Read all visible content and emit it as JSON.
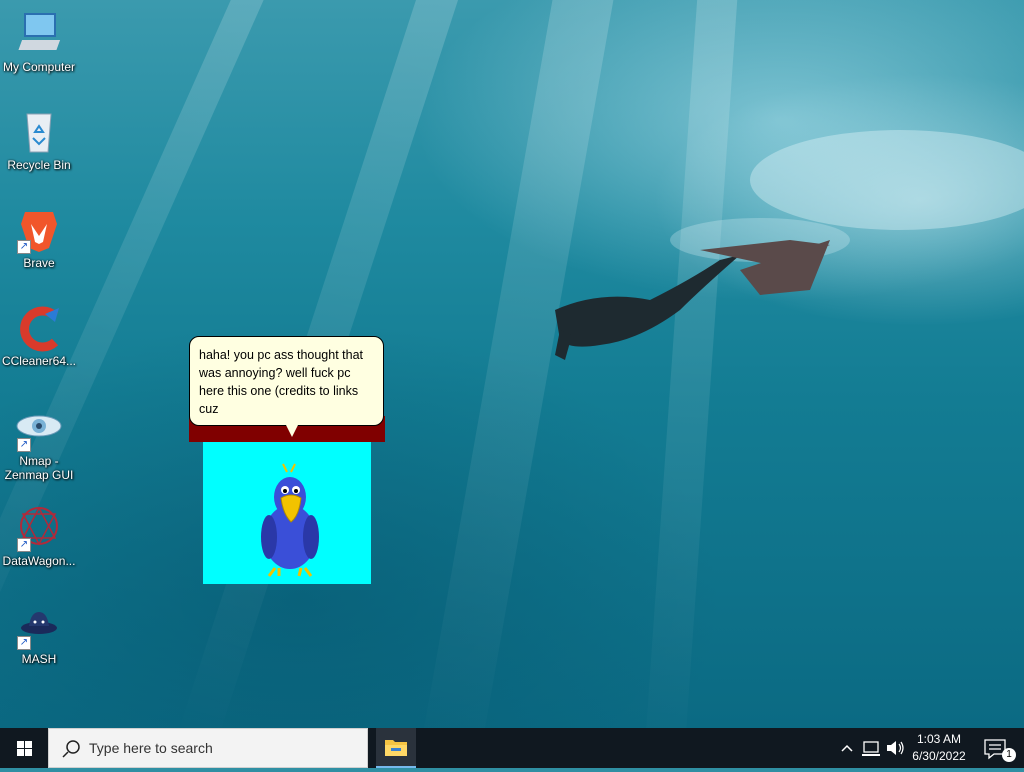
{
  "desktop": {
    "icons": [
      {
        "label": "My Computer",
        "icon": "computer-icon"
      },
      {
        "label": "Recycle Bin",
        "icon": "recycle-bin-icon"
      },
      {
        "label": "Brave",
        "icon": "brave-lion-icon"
      },
      {
        "label": "CCleaner64...",
        "icon": "ccleaner-icon"
      },
      {
        "label": "Nmap -\nZenmap GUI",
        "icon": "nmap-eye-icon"
      },
      {
        "label": "DataWagon...",
        "icon": "datawagon-icon"
      },
      {
        "label": "MASH",
        "icon": "mash-hat-icon"
      }
    ]
  },
  "agent": {
    "speech": "haha! you pc ass thought that was annoying? well fuck pc here this one (credits to links cuz",
    "character": "parrot-icon",
    "background_color": "#00ffff",
    "bar_color": "#800000"
  },
  "taskbar": {
    "search_placeholder": "Type here to search",
    "pinned": [
      {
        "name": "File Explorer",
        "icon": "folder-icon"
      }
    ],
    "tray": {
      "time": "1:03 AM",
      "date": "6/30/2022",
      "notification_count": "1",
      "icons": [
        "chevron-up-icon",
        "network-icon",
        "volume-icon"
      ]
    }
  }
}
